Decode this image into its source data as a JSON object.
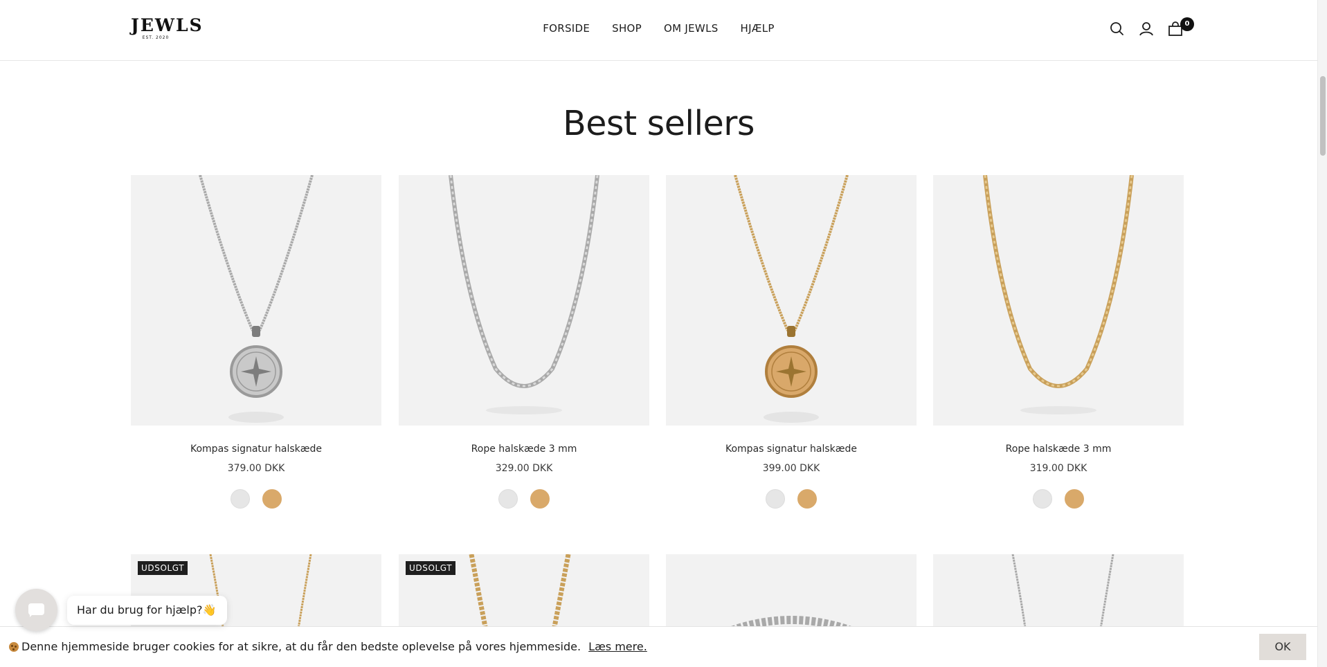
{
  "header": {
    "logo_text": "JEWLS",
    "logo_est": "EST. 2020",
    "nav": [
      "FORSIDE",
      "SHOP",
      "OM JEWLS",
      "HJÆLP"
    ],
    "cart_count": "0"
  },
  "section": {
    "title": "Best sellers"
  },
  "products": [
    {
      "name": "Kompas signatur halskæde",
      "price": "379.00 DKK",
      "swatches": [
        "silver",
        "gold"
      ],
      "metal": "silver",
      "style": "pendant"
    },
    {
      "name": "Rope halskæde 3 mm",
      "price": "329.00 DKK",
      "swatches": [
        "silver",
        "gold"
      ],
      "metal": "silver",
      "style": "rope"
    },
    {
      "name": "Kompas signatur halskæde",
      "price": "399.00 DKK",
      "swatches": [
        "silver",
        "gold"
      ],
      "metal": "gold",
      "style": "pendant"
    },
    {
      "name": "Rope halskæde 3 mm",
      "price": "319.00 DKK",
      "swatches": [
        "silver",
        "gold"
      ],
      "metal": "gold",
      "style": "rope"
    }
  ],
  "products_row2": [
    {
      "badge": "UDSOLGT",
      "metal": "gold",
      "style": "chain"
    },
    {
      "badge": "UDSOLGT",
      "metal": "gold",
      "style": "rope"
    },
    {
      "badge": "",
      "metal": "silver",
      "style": "ring"
    },
    {
      "badge": "",
      "metal": "silver",
      "style": "chain"
    }
  ],
  "colors": {
    "silver": "#e6e6e6",
    "gold": "#d9a96a",
    "card_bg": "#f2f2f2"
  },
  "chat": {
    "prompt": "Har du brug for hjælp?👋"
  },
  "cookie": {
    "text": "Denne hjemmeside bruger cookies for at sikre, at du får den bedste oplevelse på vores hjemmeside.",
    "link": "Læs mere.",
    "ok": "OK"
  }
}
